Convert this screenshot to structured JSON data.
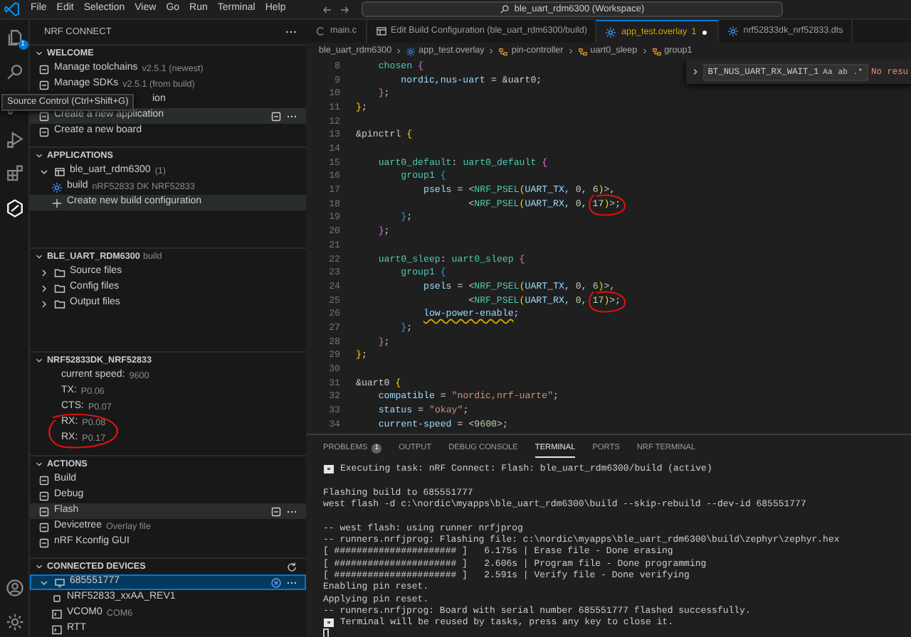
{
  "title_bar": {
    "menu": [
      "File",
      "Edit",
      "Selection",
      "View",
      "Go",
      "Run",
      "Terminal",
      "Help"
    ],
    "search": "ble_uart_rdm6300 (Workspace)"
  },
  "activity_bar": {
    "items": [
      {
        "kind": "explorer",
        "badge": "1",
        "selected": false
      },
      {
        "kind": "search",
        "selected": false
      },
      {
        "kind": "source-control",
        "selected": false
      },
      {
        "kind": "run-debug",
        "selected": false
      },
      {
        "kind": "extensions",
        "selected": false
      },
      {
        "kind": "nrf-connect",
        "selected": true
      }
    ],
    "bottom": [
      {
        "kind": "account"
      },
      {
        "kind": "settings"
      }
    ]
  },
  "tooltip": "Source Control (Ctrl+Shift+G)",
  "sidebar": {
    "title": "NRF CONNECT",
    "sections": [
      {
        "title": "WELCOME",
        "expanded": true,
        "items": [
          {
            "kind": "action",
            "label": "Manage toolchains",
            "detail": "v2.5.1 (newest)",
            "hovered": false
          },
          {
            "kind": "action",
            "label": "Manage SDKs",
            "detail": "v2.5.1 (from build)",
            "hovered": false
          },
          {
            "kind": "covered",
            "label": "ion",
            "hovered": false
          },
          {
            "kind": "action",
            "label": "Create a new application",
            "hovered": true
          },
          {
            "kind": "action",
            "label": "Create a new board",
            "hovered": false
          }
        ]
      },
      {
        "title": "APPLICATIONS",
        "expanded": true,
        "items": [
          {
            "kind": "tree",
            "label": "ble_uart_rdm6300",
            "detail": "(1)",
            "expanded": true,
            "hovered": false,
            "children": [
              {
                "kind": "leaf",
                "label": "build",
                "detail": "nRF52833 DK NRF52833",
                "hovered": false
              },
              {
                "kind": "plus",
                "label": "Create new build configuration",
                "hovered": true
              }
            ]
          }
        ]
      },
      {
        "title": "BLE_UART_RDM6300",
        "subtitle": "build",
        "expanded": true,
        "items": [
          {
            "kind": "folder",
            "label": "Source files",
            "expanded": false,
            "hovered": false
          },
          {
            "kind": "folder",
            "label": "Config files",
            "expanded": false,
            "hovered": false
          },
          {
            "kind": "folder",
            "label": "Output files",
            "expanded": false,
            "hovered": false
          }
        ]
      },
      {
        "title": "NRF52833DK_NRF52833",
        "expanded": true,
        "items": [
          {
            "kind": "prop",
            "label": "current speed:",
            "detail": "9600",
            "hovered": false,
            "circled": false
          },
          {
            "kind": "prop",
            "label": "TX:",
            "detail": "P0.06",
            "hovered": false,
            "circled": false
          },
          {
            "kind": "prop",
            "label": "CTS:",
            "detail": "P0.07",
            "hovered": false,
            "circled": false
          },
          {
            "kind": "prop",
            "label": "RX:",
            "detail": "P0.08",
            "hovered": false,
            "circled": true
          },
          {
            "kind": "prop",
            "label": "RX:",
            "detail": "P0.17",
            "hovered": false,
            "circled": true
          }
        ]
      },
      {
        "title": "ACTIONS",
        "expanded": true,
        "items": [
          {
            "kind": "action",
            "label": "Build",
            "hovered": false
          },
          {
            "kind": "action",
            "label": "Debug",
            "hovered": false
          },
          {
            "kind": "action",
            "label": "Flash",
            "hovered": true
          },
          {
            "kind": "action",
            "label": "Devicetree",
            "detail": "Overlay file",
            "hovered": false
          },
          {
            "kind": "action",
            "label": "nRF Kconfig GUI",
            "hovered": false
          }
        ]
      },
      {
        "title": "CONNECTED DEVICES",
        "expanded": true,
        "toolbar": true,
        "items": [
          {
            "kind": "device",
            "label": "685551777",
            "expanded": true,
            "selected": true,
            "children": [
              {
                "kind": "chip",
                "label": "NRF52833_xxAA_REV1",
                "selected": false
              },
              {
                "kind": "port",
                "label": "VCOM0",
                "detail": "COM6",
                "selected": false
              },
              {
                "kind": "port",
                "label": "RTT",
                "selected": false
              }
            ]
          }
        ]
      }
    ]
  },
  "editor": {
    "tabs": [
      {
        "label": "main.c",
        "kind": "c",
        "selected": false,
        "modified": false
      },
      {
        "label": "Edit Build Configuration (ble_uart_rdm6300/build)",
        "kind": "config",
        "selected": false,
        "modified": false
      },
      {
        "label": "app_test.overlay",
        "kind": "devicetree",
        "problems": "1",
        "selected": true,
        "modified": true
      },
      {
        "label": "nrf52833dk_nrf52833.dts",
        "kind": "devicetree",
        "selected": false,
        "modified": false
      }
    ],
    "breadcrumbs": [
      {
        "label": "ble_uart_rdm6300",
        "kind": "folder"
      },
      {
        "label": "app_test.overlay",
        "kind": "file"
      },
      {
        "label": "pin-controller",
        "kind": "node"
      },
      {
        "label": "uart0_sleep",
        "kind": "node"
      },
      {
        "label": "group1",
        "kind": "node"
      }
    ],
    "find": {
      "value": "BT_NUS_UART_RX_WAIT_1",
      "options": [
        "Aa",
        "ab",
        ".*"
      ],
      "result": "No resu"
    },
    "lines": [
      {
        "number": "8",
        "text": "    chosen {",
        "circled": false,
        "warning": false
      },
      {
        "number": "9",
        "text": "        nordic,nus-uart = &uart0;",
        "circled": false,
        "warning": false
      },
      {
        "number": "10",
        "text": "    };",
        "circled": false,
        "warning": false
      },
      {
        "number": "11",
        "text": "};",
        "circled": false,
        "warning": false
      },
      {
        "number": "12"
      },
      {
        "number": "13",
        "text": "&pinctrl {",
        "circled": false,
        "warning": false
      },
      {
        "number": "14"
      },
      {
        "number": "15",
        "text": "    uart0_default: uart0_default {",
        "circled": false,
        "warning": false
      },
      {
        "number": "16",
        "text": "        group1 {",
        "circled": false,
        "warning": false
      },
      {
        "number": "17",
        "text": "            psels = <NRF_PSEL(UART_TX, 0, 6)>,",
        "circled": false,
        "warning": false
      },
      {
        "number": "18",
        "text": "                    <NRF_PSEL(UART_RX, 0, 17)>;",
        "circled": true,
        "warning": false
      },
      {
        "number": "19",
        "text": "        };",
        "circled": false,
        "warning": false
      },
      {
        "number": "20",
        "text": "    };",
        "circled": false,
        "warning": false
      },
      {
        "number": "21"
      },
      {
        "number": "22",
        "text": "    uart0_sleep: uart0_sleep {",
        "circled": false,
        "warning": false
      },
      {
        "number": "23",
        "text": "        group1 {",
        "circled": false,
        "warning": false
      },
      {
        "number": "24",
        "text": "            psels = <NRF_PSEL(UART_TX, 0, 6)>,",
        "circled": false,
        "warning": false
      },
      {
        "number": "25",
        "text": "                    <NRF_PSEL(UART_RX, 0, 17)>;",
        "circled": true,
        "warning": false
      },
      {
        "number": "26",
        "text": "            low-power-enable;",
        "circled": false,
        "warning": true
      },
      {
        "number": "27",
        "text": "        };",
        "circled": false,
        "warning": false
      },
      {
        "number": "28",
        "text": "    };",
        "circled": false,
        "warning": false
      },
      {
        "number": "29",
        "text": "};",
        "circled": false,
        "warning": false
      },
      {
        "number": "30"
      },
      {
        "number": "31",
        "text": "&uart0 {",
        "circled": false,
        "warning": false
      },
      {
        "number": "32",
        "text": "    compatible = \"nordic,nrf-uarte\";",
        "circled": false,
        "warning": false
      },
      {
        "number": "33",
        "text": "    status = \"okay\";",
        "circled": false,
        "warning": false
      },
      {
        "number": "34",
        "text": "    current-speed = <9600>;",
        "circled": false,
        "warning": false
      }
    ]
  },
  "panel": {
    "tabs": [
      {
        "label": "PROBLEMS",
        "badge": "1",
        "selected": false
      },
      {
        "label": "OUTPUT",
        "selected": false
      },
      {
        "label": "DEBUG CONSOLE",
        "selected": false
      },
      {
        "label": "TERMINAL",
        "selected": true
      },
      {
        "label": "PORTS",
        "selected": false
      },
      {
        "label": "NRF TERMINAL",
        "selected": false
      }
    ],
    "terminal": [
      {
        "kind": "task",
        "text": "Executing task: nRF Connect: Flash: ble_uart_rdm6300/build (active)"
      },
      {
        "kind": "blank"
      },
      {
        "kind": "output",
        "text": "Flashing build to 685551777"
      },
      {
        "kind": "output",
        "text": "west flash -d c:\\nordic\\myapps\\ble_uart_rdm6300\\build --skip-rebuild --dev-id 685551777"
      },
      {
        "kind": "blank"
      },
      {
        "kind": "output",
        "text": "-- west flash: using runner nrfjprog"
      },
      {
        "kind": "output",
        "text": "-- runners.nrfjprog: Flashing file: c:\\nordic\\myapps\\ble_uart_rdm6300\\build\\zephyr\\zephyr.hex"
      },
      {
        "kind": "output",
        "text": "[ ###################### ]   6.175s | Erase file - Done erasing"
      },
      {
        "kind": "output",
        "text": "[ ###################### ]   2.606s | Program file - Done programming"
      },
      {
        "kind": "output",
        "text": "[ ###################### ]   2.591s | Verify file - Done verifying"
      },
      {
        "kind": "output",
        "text": "Enabling pin reset."
      },
      {
        "kind": "output",
        "text": "Applying pin reset."
      },
      {
        "kind": "output",
        "text": "-- runners.nrfjprog: Board with serial number 685551777 flashed successfully."
      },
      {
        "kind": "task",
        "text": "Terminal will be reused by tasks, press any key to close it."
      },
      {
        "kind": "cursor"
      }
    ]
  }
}
